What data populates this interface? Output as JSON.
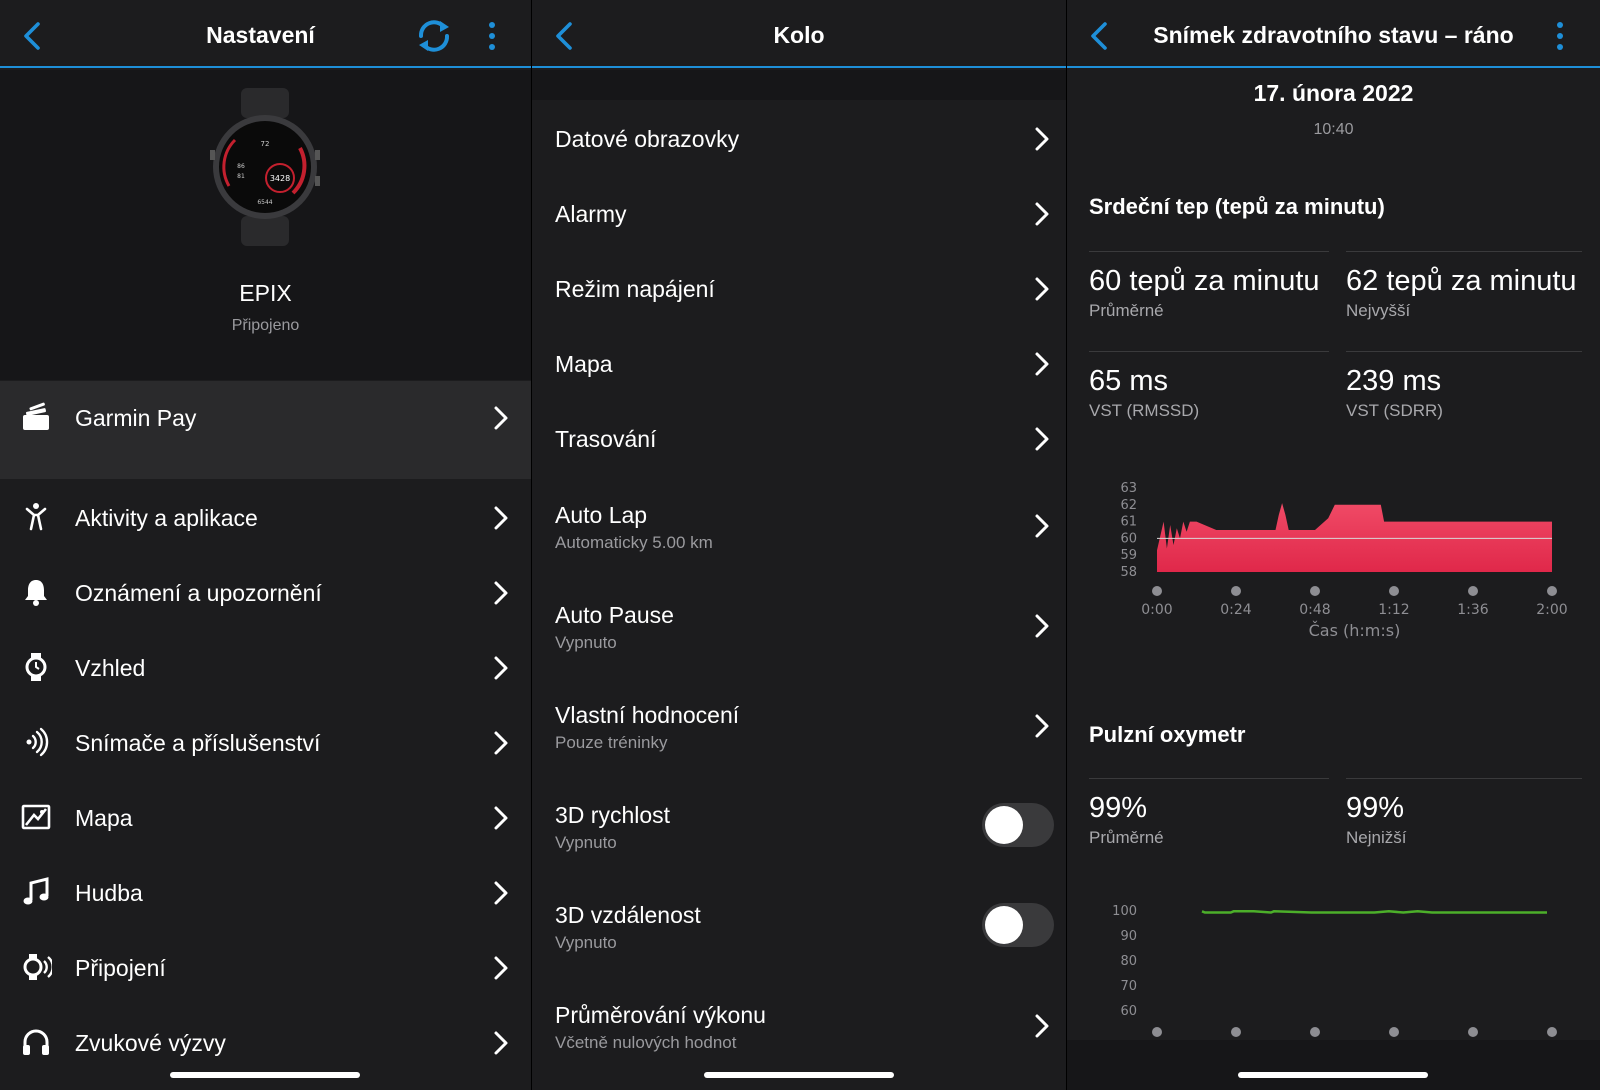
{
  "settings": {
    "title": "Nastavení",
    "device_name": "EPIX",
    "device_status": "Připojeno",
    "watch_face": {
      "top": "72",
      "left": "86",
      "mid": "81",
      "right": "3428",
      "low": "6544"
    },
    "garmin_pay": "Garmin Pay",
    "items": [
      {
        "label": "Aktivity a aplikace",
        "icon": "figure-icon"
      },
      {
        "label": "Oznámení a upozornění",
        "icon": "bell-icon"
      },
      {
        "label": "Vzhled",
        "icon": "watch-icon"
      },
      {
        "label": "Snímače a příslušenství",
        "icon": "sensor-icon"
      },
      {
        "label": "Mapa",
        "icon": "map-icon"
      },
      {
        "label": "Hudba",
        "icon": "music-icon"
      },
      {
        "label": "Připojení",
        "icon": "connection-icon"
      },
      {
        "label": "Zvukové výzvy",
        "icon": "headphones-icon"
      }
    ]
  },
  "bike": {
    "title": "Kolo",
    "items": [
      {
        "label": "Datové obrazovky",
        "sub": ""
      },
      {
        "label": "Alarmy",
        "sub": ""
      },
      {
        "label": "Režim napájení",
        "sub": ""
      },
      {
        "label": "Mapa",
        "sub": ""
      },
      {
        "label": "Trasování",
        "sub": ""
      },
      {
        "label": "Auto Lap",
        "sub": "Automaticky 5.00 km"
      },
      {
        "label": "Auto Pause",
        "sub": "Vypnuto"
      },
      {
        "label": "Vlastní hodnocení",
        "sub": "Pouze tréninky"
      },
      {
        "label": "3D rychlost",
        "sub": "Vypnuto",
        "toggle": false
      },
      {
        "label": "3D vzdálenost",
        "sub": "Vypnuto",
        "toggle": false
      },
      {
        "label": "Průměrování výkonu",
        "sub": "Včetně nulových hodnot"
      }
    ]
  },
  "health": {
    "title": "Snímek zdravotního stavu – ráno",
    "date": "17. února 2022",
    "time": "10:40",
    "hr_title": "Srdeční tep (tepů za minutu)",
    "hr_stats": [
      {
        "value": "60 tepů za minutu",
        "label": "Průměrné"
      },
      {
        "value": "62 tepů za minutu",
        "label": "Nejvyšší"
      },
      {
        "value": "65 ms",
        "label": "VST (RMSSD)"
      },
      {
        "value": "239 ms",
        "label": "VST (SDRR)"
      }
    ],
    "ox_title": "Pulzní oxymetr",
    "ox_stats": [
      {
        "value": "99%",
        "label": "Průměrné"
      },
      {
        "value": "99%",
        "label": "Nejnižší"
      }
    ],
    "hr_chart": {
      "type": "area",
      "yticks": [
        "63",
        "62",
        "61",
        "60",
        "59",
        "58"
      ],
      "ylim": [
        58,
        63
      ],
      "xticks": [
        "0:00",
        "0:24",
        "0:48",
        "1:12",
        "1:36",
        "2:00"
      ],
      "xlabel": "Čas (h:m:s)",
      "color": "#e0284a",
      "baseline": 60,
      "x": [
        0,
        2,
        3,
        4,
        5,
        6,
        7,
        8,
        9,
        10,
        12,
        18,
        24,
        36,
        37,
        38,
        39,
        40,
        45,
        48,
        52,
        54,
        56,
        68,
        69,
        120
      ],
      "y": [
        59.3,
        61,
        59.4,
        60.8,
        59.6,
        60.6,
        60,
        61,
        60.4,
        61,
        61,
        60.5,
        60.5,
        60.5,
        61.4,
        62.1,
        61.4,
        60.5,
        60.5,
        60.5,
        61.2,
        62,
        62,
        62,
        61,
        61
      ]
    },
    "ox_chart": {
      "type": "line",
      "yticks": [
        "100",
        "90",
        "80",
        "70",
        "60"
      ],
      "ylim": [
        60,
        100
      ],
      "color": "#4caf2a",
      "x": [
        0,
        1,
        10,
        11,
        18,
        24,
        25,
        38,
        48,
        60,
        65,
        70,
        75,
        80,
        90,
        120
      ],
      "y": [
        99.5,
        99,
        99,
        99.5,
        99.5,
        99,
        99.5,
        99,
        99,
        99,
        99.5,
        99,
        99.5,
        99,
        99,
        99
      ]
    }
  }
}
